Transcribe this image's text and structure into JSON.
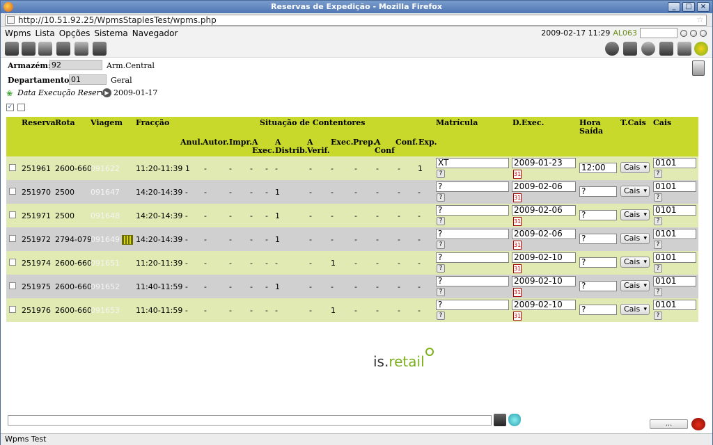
{
  "window": {
    "title": "Reservas de Expedição - Mozilla Firefox"
  },
  "browser": {
    "url": "http://10.51.92.25/WpmsStaplesTest/wpms.php",
    "status": "Wpms Test"
  },
  "menu": {
    "items": [
      "Wpms",
      "Lista",
      "Opções",
      "Sistema",
      "Navegador"
    ],
    "datetime": "2009-02-17 11:29",
    "user": "AL063"
  },
  "form": {
    "armazem_label": "Armazém:",
    "armazem_value": "92",
    "armazem_name": "Arm.Central",
    "departamento_label": "Departamento:",
    "departamento_value": "01",
    "departamento_name": "Geral",
    "data_label": "Data Execução Reserva",
    "data_value": "2009-01-17"
  },
  "table": {
    "headers": {
      "reserva": "Reserva",
      "rota": "Rota",
      "viagem": "Viagem",
      "fraccao": "Fracção",
      "situacao": "Situação de Contentores",
      "anul": "Anul.",
      "autor": "Autor.",
      "impr": "Impr.",
      "a_exec_1": "A",
      "a_exec_2": "Exec.",
      "a_distrib_1": "A",
      "a_distrib_2": "Distrib.",
      "a_verif_1": "A",
      "a_verif_2": "Verif.",
      "exec": "Exec.",
      "prep": "Prep.",
      "a_conf_1": "A",
      "a_conf_2": "Conf",
      "conf": "Conf.",
      "exp": "Exp.",
      "matricula": "Matrícula",
      "dexec": "D.Exec.",
      "hora_1": "Hora",
      "hora_2": "Saída",
      "tcais": "T.Cais",
      "cais": "Cais"
    },
    "rows": [
      {
        "reserva": "251961",
        "rota": "2600-660",
        "viagem": "091622",
        "fraccao": "11:20-11:39 1",
        "anul": "-",
        "autor": "-",
        "impr": "-",
        "aexec": "-",
        "adistrib": "-",
        "averif": "-",
        "exec": "-",
        "prep": "-",
        "aconf": "-",
        "conf": "-",
        "exp": "1",
        "matricula": "XT",
        "dexec": "2009-01-23",
        "hora": "12:00",
        "tcais": "Cais",
        "cais": "0101",
        "q": "?",
        "cal": "31",
        "style": "a"
      },
      {
        "reserva": "251970",
        "rota": "2500",
        "viagem": "091647",
        "fraccao": "14:20-14:39 -",
        "anul": "-",
        "autor": "-",
        "impr": "-",
        "aexec": "-",
        "adistrib": "1",
        "averif": "-",
        "exec": "-",
        "prep": "-",
        "aconf": "-",
        "conf": "-",
        "exp": "-",
        "matricula": "?",
        "dexec": "2009-02-06",
        "hora": "?",
        "tcais": "Cais",
        "cais": "0101",
        "q": "?",
        "cal": "31",
        "style": "b"
      },
      {
        "reserva": "251971",
        "rota": "2500",
        "viagem": "091648",
        "fraccao": "14:20-14:39 -",
        "anul": "-",
        "autor": "-",
        "impr": "-",
        "aexec": "-",
        "adistrib": "1",
        "averif": "-",
        "exec": "-",
        "prep": "-",
        "aconf": "-",
        "conf": "-",
        "exp": "-",
        "matricula": "?",
        "dexec": "2009-02-06",
        "hora": "?",
        "tcais": "Cais",
        "cais": "0101",
        "q": "?",
        "cal": "31",
        "style": "a"
      },
      {
        "reserva": "251972",
        "rota": "2794-079",
        "viagem": "091649",
        "fraccao": "14:20-14:39 -",
        "anul": "-",
        "autor": "-",
        "impr": "-",
        "aexec": "-",
        "adistrib": "1",
        "averif": "-",
        "exec": "-",
        "prep": "-",
        "aconf": "-",
        "conf": "-",
        "exp": "-",
        "matricula": "?",
        "dexec": "2009-02-06",
        "hora": "?",
        "tcais": "Cais",
        "cais": "0101",
        "q": "?",
        "cal": "31",
        "style": "b",
        "calendar_icon": true
      },
      {
        "reserva": "251974",
        "rota": "2600-660",
        "viagem": "091651",
        "fraccao": "11:20-11:39 -",
        "anul": "-",
        "autor": "-",
        "impr": "-",
        "aexec": "-",
        "adistrib": "-",
        "averif": "-",
        "exec": "1",
        "prep": "-",
        "aconf": "-",
        "conf": "-",
        "exp": "-",
        "matricula": "?",
        "dexec": "2009-02-10",
        "hora": "?",
        "tcais": "Cais",
        "cais": "0101",
        "q": "?",
        "cal": "31",
        "style": "a"
      },
      {
        "reserva": "251975",
        "rota": "2600-660",
        "viagem": "091652",
        "fraccao": "11:40-11:59 -",
        "anul": "-",
        "autor": "-",
        "impr": "-",
        "aexec": "-",
        "adistrib": "1",
        "averif": "-",
        "exec": "-",
        "prep": "-",
        "aconf": "-",
        "conf": "-",
        "exp": "-",
        "matricula": "?",
        "dexec": "2009-02-10",
        "hora": "?",
        "tcais": "Cais",
        "cais": "0101",
        "q": "?",
        "cal": "31",
        "style": "b"
      },
      {
        "reserva": "251976",
        "rota": "2600-660",
        "viagem": "091653",
        "fraccao": "11:40-11:59 -",
        "anul": "-",
        "autor": "-",
        "impr": "-",
        "aexec": "-",
        "adistrib": "-",
        "averif": "-",
        "exec": "1",
        "prep": "-",
        "aconf": "-",
        "conf": "-",
        "exp": "-",
        "matricula": "?",
        "dexec": "2009-02-10",
        "hora": "?",
        "tcais": "Cais",
        "cais": "0101",
        "q": "?",
        "cal": "31",
        "style": "a"
      }
    ]
  },
  "logo": {
    "part1": "is.",
    "part2": "retail"
  },
  "bottom": {
    "dots_label": "..."
  },
  "colors": {
    "header": "#c8d92c",
    "row_light": "#e0eab2",
    "row_gray": "#d0d0d0"
  }
}
